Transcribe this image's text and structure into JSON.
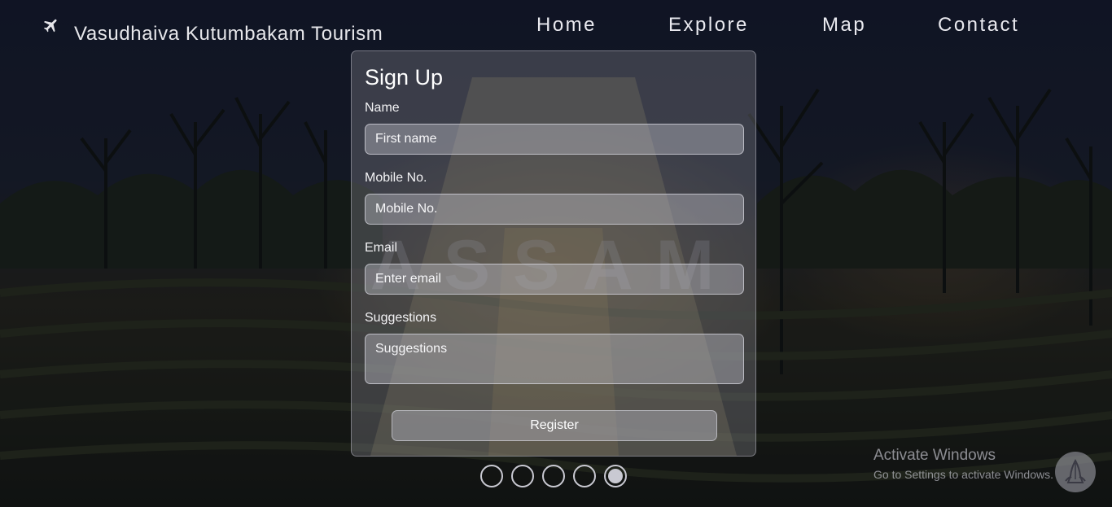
{
  "brand": {
    "title": "Vasudhaiva Kutumbakam Tourism",
    "icon": "airplane-icon"
  },
  "nav": {
    "items": [
      {
        "label": "Home"
      },
      {
        "label": "Explore"
      },
      {
        "label": "Map"
      },
      {
        "label": "Contact"
      }
    ]
  },
  "hero": {
    "background_text": "ASSAM"
  },
  "form": {
    "title": "Sign Up",
    "name_label": "Name",
    "name_placeholder": "First name",
    "mobile_label": "Mobile No.",
    "mobile_placeholder": "Mobile No.",
    "email_label": "Email",
    "email_placeholder": "Enter email",
    "suggestions_label": "Suggestions",
    "suggestions_placeholder": "Suggestions",
    "register_label": "Register"
  },
  "slider": {
    "count": 5,
    "active_index": 4
  },
  "watermark": {
    "title": "Activate Windows",
    "subtitle": "Go to Settings to activate Windows."
  },
  "colors": {
    "text": "#e9e9ef",
    "card_bg": "#7d7d87",
    "dot": "#c9c9d2"
  }
}
